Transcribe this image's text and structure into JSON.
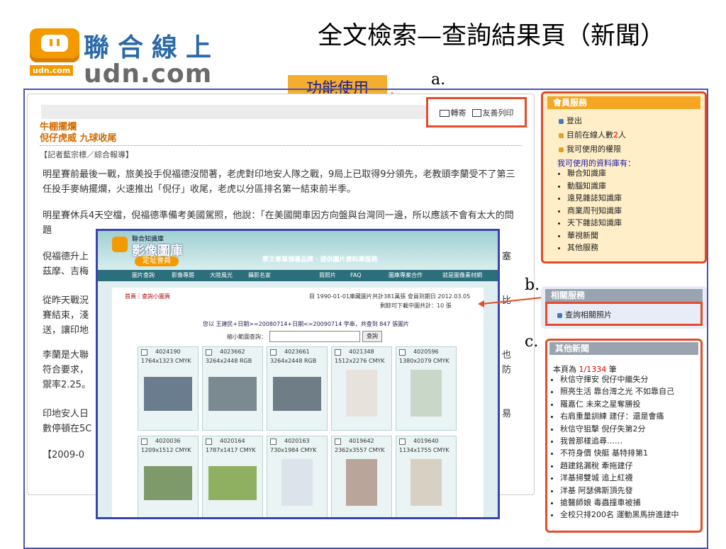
{
  "header": {
    "logo_cn": "聯合線上",
    "logo_udn_small": "udn.com",
    "logo_com": "udn.com",
    "slide_title": "全文檢索—查詢結果頁（新聞）",
    "function_label": "功能使用"
  },
  "annotations": {
    "a": "a.",
    "b": "b.",
    "c": "c."
  },
  "toolbar": {
    "forward": "轉寄",
    "print": "友善列印"
  },
  "article": {
    "kicker": "牛棚擺爛",
    "headline": "倪仔虎威 九球收尾",
    "byline": "【記者藍宗標／綜合報導】",
    "paragraphs": [
      "明星賽前最後一戰，旅美投手倪福德沒閒著，老虎對印地安人隊之戰，9局上已取得9分領先，老教頭李蘭受不了第三任投手麥納擺爛，火速推出「倪仔」收尾，老虎以分區排名第一結束前半季。",
      "明星賽休兵4天空檔，倪福德準備考美國駕照，他說：「在美國開車因方向盤與台灣同一邊，所以應該不會有太大的問題",
      "倪福德升上",
      "塞",
      "茲摩、吉梅",
      "從昨天戰況",
      "比",
      "賽結束，淺",
      "送，讓印地",
      "李蘭是大聯",
      "也",
      "符合要求，",
      "防",
      "禦率2.25。",
      "印地安人日",
      "易",
      "數停頓在5C",
      "【2009-0"
    ]
  },
  "popup": {
    "brand_small": "聯合知識庫",
    "brand_big": "影像圖庫",
    "brand_tag": "定址會員",
    "slogan": "華文專業領導品牌 · 提供圖片資料庫服務",
    "nav": [
      "圖片查詢",
      "影像專題",
      "大陸風光",
      "攝影名家",
      "買照片",
      "FAQ",
      "圖庫專案合作",
      "就是圖像素材網"
    ],
    "crumb": "首頁｜查詢小圖頁",
    "range_info": "目 1990-01-01庫藏圖片共計381萬張  會員到期日 2012.03.05",
    "remain_info": "剩餘可下載中圖共計：10 張",
    "query_text": "您以 王建民+日期>=20080714+日期<=20090714 字串，共查到 847 張圖片",
    "narrow_label": "縮小範圍查詢：",
    "search_btn": "查詢",
    "thumbs": [
      {
        "id": "4024190",
        "spec": "1764x1323 CMYK"
      },
      {
        "id": "4023662",
        "spec": "3264x2448 RGB"
      },
      {
        "id": "4023661",
        "spec": "3264x2448 RGB"
      },
      {
        "id": "4021348",
        "spec": "1512x2276 CMYK"
      },
      {
        "id": "4020596",
        "spec": "1380x2079 CMYK"
      },
      {
        "id": "4020036",
        "spec": "1209x1512 CMYK"
      },
      {
        "id": "4020164",
        "spec": "1787x1417 CMYK"
      },
      {
        "id": "4020163",
        "spec": "730x1984 CMYK"
      },
      {
        "id": "4019642",
        "spec": "2362x3557 CMYK"
      },
      {
        "id": "4019640",
        "spec": "1134x1755 CMYK"
      }
    ]
  },
  "member": {
    "title": "會員服務",
    "logout": "登出",
    "online_prefix": "目前在線人數",
    "online_count": "2",
    "online_suffix": "人",
    "perms": "我可使用的權限",
    "db_header": "我可使用的資料庫有：",
    "dbs": [
      "聯合知識庫",
      "動腦知識庫",
      "遠見雜誌知識庫",
      "商業周刊知識庫",
      "天下雜誌知識庫",
      "華視新聞",
      "其他服務"
    ]
  },
  "related": {
    "title": "相關服務",
    "item": "查詢相關照片"
  },
  "other_news": {
    "title": "其他新聞",
    "page_prefix": "本頁為",
    "page_value": "1/1334",
    "page_suffix": "筆",
    "items": [
      "秋信守揮安 倪仔中繼失分",
      "照亮生活 靠台灣之光 不如靠自己",
      "羅嘉仁 未來之星奪勝投",
      "右肩重量訓練 建仔：還是會痛",
      "秋信守狙擊 倪仔失第2分",
      "我曾那樣追尋……",
      "不符身價 快艇 基特排第1",
      "趙建銘漏稅 牽拖建仔",
      "洋基掃雙城 追上紅襪",
      "洋基 阿瑟佛斯頂先發",
      "搶醫師娘 毒蟲撞車被捕",
      "全校只排200名 運動黑馬拚進建中"
    ]
  },
  "colors": {
    "accent_red": "#e34b2b",
    "frame_blue": "#4a55b0",
    "side_orange": "#f5a623",
    "side_grey": "#9aa3b0",
    "udn_orange": "#f29a00"
  }
}
